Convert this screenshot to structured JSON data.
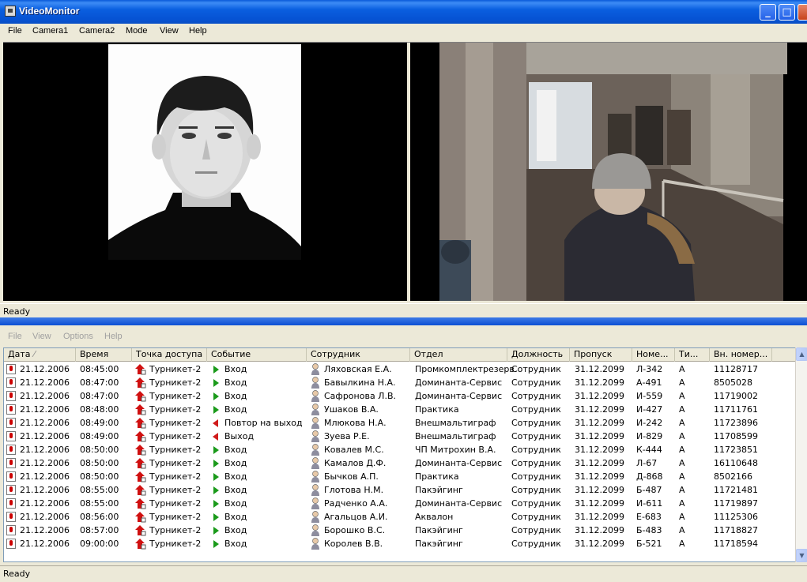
{
  "window": {
    "title": "VideoMonitor"
  },
  "menu": [
    "File",
    "Camera1",
    "Camera2",
    "Mode",
    "View",
    "Help"
  ],
  "status_top": "Ready",
  "menu2": [
    "File",
    "View",
    "Options",
    "Help"
  ],
  "columns": [
    "Дата",
    "Время",
    "Точка доступа",
    "Событие",
    "Сотрудник",
    "Отдел",
    "Должность",
    "Пропуск",
    "Номе...",
    "Ти...",
    "Вн. номер..."
  ],
  "rows": [
    {
      "date": "21.12.2006",
      "time": "08:45:00",
      "point": "Турникет-2",
      "event": "Вход",
      "evt": "in",
      "emp": "Ляховская Е.А.",
      "dept": "Промкомплектрезерв",
      "pos": "Сотрудник",
      "pass": "31.12.2099",
      "num": "Л-342",
      "type": "А",
      "ext": "11128717"
    },
    {
      "date": "21.12.2006",
      "time": "08:47:00",
      "point": "Турникет-2",
      "event": "Вход",
      "evt": "in",
      "emp": "Бавылкина Н.А.",
      "dept": "Доминанта-Сервис",
      "pos": "Сотрудник",
      "pass": "31.12.2099",
      "num": "А-491",
      "type": "А",
      "ext": "8505028"
    },
    {
      "date": "21.12.2006",
      "time": "08:47:00",
      "point": "Турникет-2",
      "event": "Вход",
      "evt": "in",
      "emp": "Сафронова Л.В.",
      "dept": "Доминанта-Сервис",
      "pos": "Сотрудник",
      "pass": "31.12.2099",
      "num": "И-559",
      "type": "А",
      "ext": "11719002"
    },
    {
      "date": "21.12.2006",
      "time": "08:48:00",
      "point": "Турникет-2",
      "event": "Вход",
      "evt": "in",
      "emp": "Ушаков В.А.",
      "dept": "Практика",
      "pos": "Сотрудник",
      "pass": "31.12.2099",
      "num": "И-427",
      "type": "А",
      "ext": "11711761"
    },
    {
      "date": "21.12.2006",
      "time": "08:49:00",
      "point": "Турникет-2",
      "event": "Повтор на выход",
      "evt": "out",
      "emp": "Млюкова Н.А.",
      "dept": "Внешмальтиграф",
      "pos": "Сотрудник",
      "pass": "31.12.2099",
      "num": "И-242",
      "type": "А",
      "ext": "11723896"
    },
    {
      "date": "21.12.2006",
      "time": "08:49:00",
      "point": "Турникет-2",
      "event": "Выход",
      "evt": "out",
      "emp": "Зуева Р.Е.",
      "dept": "Внешмальтиграф",
      "pos": "Сотрудник",
      "pass": "31.12.2099",
      "num": "И-829",
      "type": "А",
      "ext": "11708599"
    },
    {
      "date": "21.12.2006",
      "time": "08:50:00",
      "point": "Турникет-2",
      "event": "Вход",
      "evt": "in",
      "emp": "Ковалев М.С.",
      "dept": "ЧП Митрохин В.А.",
      "pos": "Сотрудник",
      "pass": "31.12.2099",
      "num": "К-444",
      "type": "А",
      "ext": "11723851"
    },
    {
      "date": "21.12.2006",
      "time": "08:50:00",
      "point": "Турникет-2",
      "event": "Вход",
      "evt": "in",
      "emp": "Камалов Д.Ф.",
      "dept": "Доминанта-Сервис",
      "pos": "Сотрудник",
      "pass": "31.12.2099",
      "num": "Л-67",
      "type": "А",
      "ext": "16110648"
    },
    {
      "date": "21.12.2006",
      "time": "08:50:00",
      "point": "Турникет-2",
      "event": "Вход",
      "evt": "in",
      "emp": "Бычков А.П.",
      "dept": "Практика",
      "pos": "Сотрудник",
      "pass": "31.12.2099",
      "num": "Д-868",
      "type": "А",
      "ext": "8502166"
    },
    {
      "date": "21.12.2006",
      "time": "08:55:00",
      "point": "Турникет-2",
      "event": "Вход",
      "evt": "in",
      "emp": "Глотова Н.М.",
      "dept": "Пакэйгинг",
      "pos": "Сотрудник",
      "pass": "31.12.2099",
      "num": "Б-487",
      "type": "А",
      "ext": "11721481"
    },
    {
      "date": "21.12.2006",
      "time": "08:55:00",
      "point": "Турникет-2",
      "event": "Вход",
      "evt": "in",
      "emp": "Радченко А.А.",
      "dept": "Доминанта-Сервис",
      "pos": "Сотрудник",
      "pass": "31.12.2099",
      "num": "И-611",
      "type": "А",
      "ext": "11719897"
    },
    {
      "date": "21.12.2006",
      "time": "08:56:00",
      "point": "Турникет-2",
      "event": "Вход",
      "evt": "in",
      "emp": "Агальцов А.И.",
      "dept": "Аквалон",
      "pos": "Сотрудник",
      "pass": "31.12.2099",
      "num": "Е-683",
      "type": "А",
      "ext": "11125306"
    },
    {
      "date": "21.12.2006",
      "time": "08:57:00",
      "point": "Турникет-2",
      "event": "Вход",
      "evt": "in",
      "emp": "Борошко В.С.",
      "dept": "Пакэйгинг",
      "pos": "Сотрудник",
      "pass": "31.12.2099",
      "num": "Б-483",
      "type": "А",
      "ext": "11718827"
    },
    {
      "date": "21.12.2006",
      "time": "09:00:00",
      "point": "Турникет-2",
      "event": "Вход",
      "evt": "in",
      "emp": "Королев В.В.",
      "dept": "Пакэйгинг",
      "pos": "Сотрудник",
      "pass": "31.12.2099",
      "num": "Б-521",
      "type": "А",
      "ext": "11718594"
    }
  ],
  "status_bottom": "Ready",
  "icons": {
    "row": "alarm-card-icon",
    "point": "turnstile-arrow-icon",
    "event_in": "green-triangle-icon",
    "event_out": "red-triangle-icon",
    "employee": "person-icon"
  },
  "colors": {
    "title_bar": "#0a5ad9",
    "event_in": "#1a9a1a",
    "event_out": "#d01c1c"
  }
}
